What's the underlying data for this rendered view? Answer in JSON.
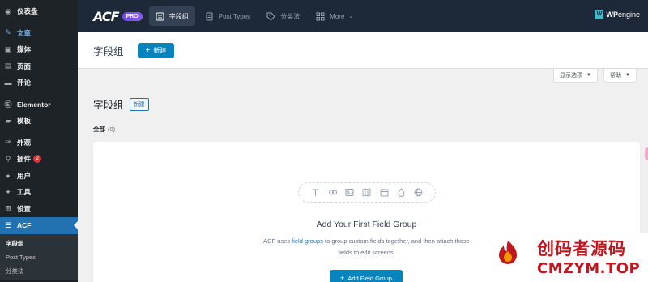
{
  "sidebar": {
    "items": [
      {
        "label": "仪表盘",
        "icon": "dashboard-icon",
        "glyph": "◉"
      },
      {
        "label": "文章",
        "icon": "pin-icon",
        "glyph": "✎"
      },
      {
        "label": "媒体",
        "icon": "media-icon",
        "glyph": "▣"
      },
      {
        "label": "页面",
        "icon": "page-icon",
        "glyph": "▤"
      },
      {
        "label": "评论",
        "icon": "comment-icon",
        "glyph": "▬"
      },
      {
        "label": "Elementor",
        "icon": "elementor-icon",
        "glyph": "Ⓔ"
      },
      {
        "label": "模板",
        "icon": "folder-icon",
        "glyph": "▰"
      },
      {
        "label": "外观",
        "icon": "brush-icon",
        "glyph": "✑"
      },
      {
        "label": "插件",
        "icon": "plugin-icon",
        "glyph": "⚲",
        "badge": "2"
      },
      {
        "label": "用户",
        "icon": "user-icon",
        "glyph": "●"
      },
      {
        "label": "工具",
        "icon": "wrench-icon",
        "glyph": "✦"
      },
      {
        "label": "设置",
        "icon": "settings-icon",
        "glyph": "⊞"
      },
      {
        "label": "ACF",
        "icon": "acf-icon",
        "glyph": "☰"
      }
    ],
    "submenu": [
      {
        "label": "字段组"
      },
      {
        "label": "Post Types"
      },
      {
        "label": "分类法"
      }
    ]
  },
  "acf_bar": {
    "logo": "ACF",
    "pro": "PRO",
    "tabs": [
      {
        "label": "字段组"
      },
      {
        "label": "Post Types"
      },
      {
        "label": "分类法"
      },
      {
        "label": "More"
      }
    ],
    "brand_wp": "WP",
    "brand_engine": "engine",
    "brand_mark": "W"
  },
  "header": {
    "title": "字段组",
    "new_button": "新建"
  },
  "screen_options": {
    "label": "显示选项",
    "help": "帮助"
  },
  "page": {
    "title": "字段组",
    "new_button": "新建",
    "filter_all": "全部",
    "filter_count": "(0)"
  },
  "empty_state": {
    "title": "Add Your First Field Group",
    "desc_pre": "ACF uses ",
    "desc_link": "field groups",
    "desc_post": " to group custom fields together, and then attach those fields to edit screens.",
    "button": "Add Field Group"
  },
  "watermark": {
    "cn": "创码者源码",
    "en": "CMZYM.TOP"
  },
  "colors": {
    "sidebar_bg": "#1d2327",
    "acf_bar_bg": "#1d2939",
    "primary": "#0783be",
    "wp_blue": "#2271b1",
    "watermark_red": "#c0171f"
  }
}
